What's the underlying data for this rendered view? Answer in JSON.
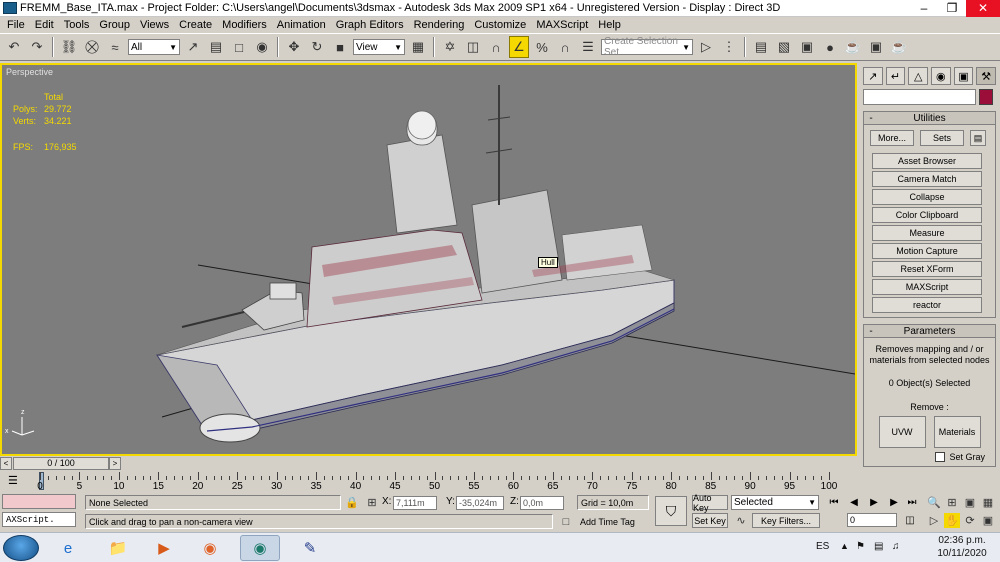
{
  "window": {
    "title": "FREMM_Base_ITA.max    - Project Folder: C:\\Users\\angel\\Documents\\3dsmax    - Autodesk 3ds Max  2009 SP1  x64   - Unregistered Version    - Display : Direct 3D"
  },
  "menu": [
    "File",
    "Edit",
    "Tools",
    "Group",
    "Views",
    "Create",
    "Modifiers",
    "Animation",
    "Graph Editors",
    "Rendering",
    "Customize",
    "MAXScript",
    "Help"
  ],
  "toolbar": {
    "selection_filter": "All",
    "reference_coord": "View",
    "named_selection_placeholder": "Create Selection Set"
  },
  "viewport": {
    "label": "Perspective",
    "stats": {
      "header": "Total",
      "polys_label": "Polys:",
      "polys_value": "29.772",
      "verts_label": "Verts:",
      "verts_value": "34.221",
      "fps_label": "FPS:",
      "fps_value": "176,935"
    },
    "tooltip": "Hull"
  },
  "command_panel": {
    "utilities": {
      "title": "Utilities",
      "more_label": "More...",
      "sets_label": "Sets",
      "items": [
        "Asset Browser",
        "Camera Match",
        "Collapse",
        "Color Clipboard",
        "Measure",
        "Motion Capture",
        "Reset XForm",
        "MAXScript",
        "reactor"
      ]
    },
    "parameters": {
      "title": "Parameters",
      "description": "Removes mapping and / or materials from selected nodes",
      "selection": "0 Object(s) Selected",
      "remove_label": "Remove :",
      "uvw_label": "UVW",
      "materials_label": "Materials",
      "set_gray_label": "Set Gray"
    }
  },
  "timeline": {
    "slider": "0 / 100",
    "ticks": [
      "0",
      "5",
      "10",
      "15",
      "20",
      "25",
      "30",
      "35",
      "40",
      "45",
      "50",
      "55",
      "60",
      "65",
      "70",
      "75",
      "80",
      "85",
      "90",
      "95",
      "100"
    ]
  },
  "status": {
    "listener": "AXScript.",
    "selection": "None Selected",
    "prompt": "Click and drag to pan a non-camera view",
    "x_label": "X:",
    "x_value": "7,111m",
    "y_label": "Y:",
    "y_value": "-35,024m",
    "z_label": "Z:",
    "z_value": "0,0m",
    "grid": "Grid = 10,0m",
    "add_time_tag": "Add Time Tag",
    "auto_key": "Auto Key",
    "set_key": "Set Key",
    "key_mode": "Selected",
    "key_filters": "Key Filters...",
    "current_frame": "0"
  },
  "taskbar": {
    "lang": "ES",
    "time": "02:36 p.m.",
    "date": "10/11/2020"
  },
  "colors": {
    "viewport_bg": "#7d7d7d",
    "viewport_border": "#f4d900",
    "stats_text": "#f4d900",
    "object_color": "#9b0e3a",
    "close_button": "#e81123"
  }
}
